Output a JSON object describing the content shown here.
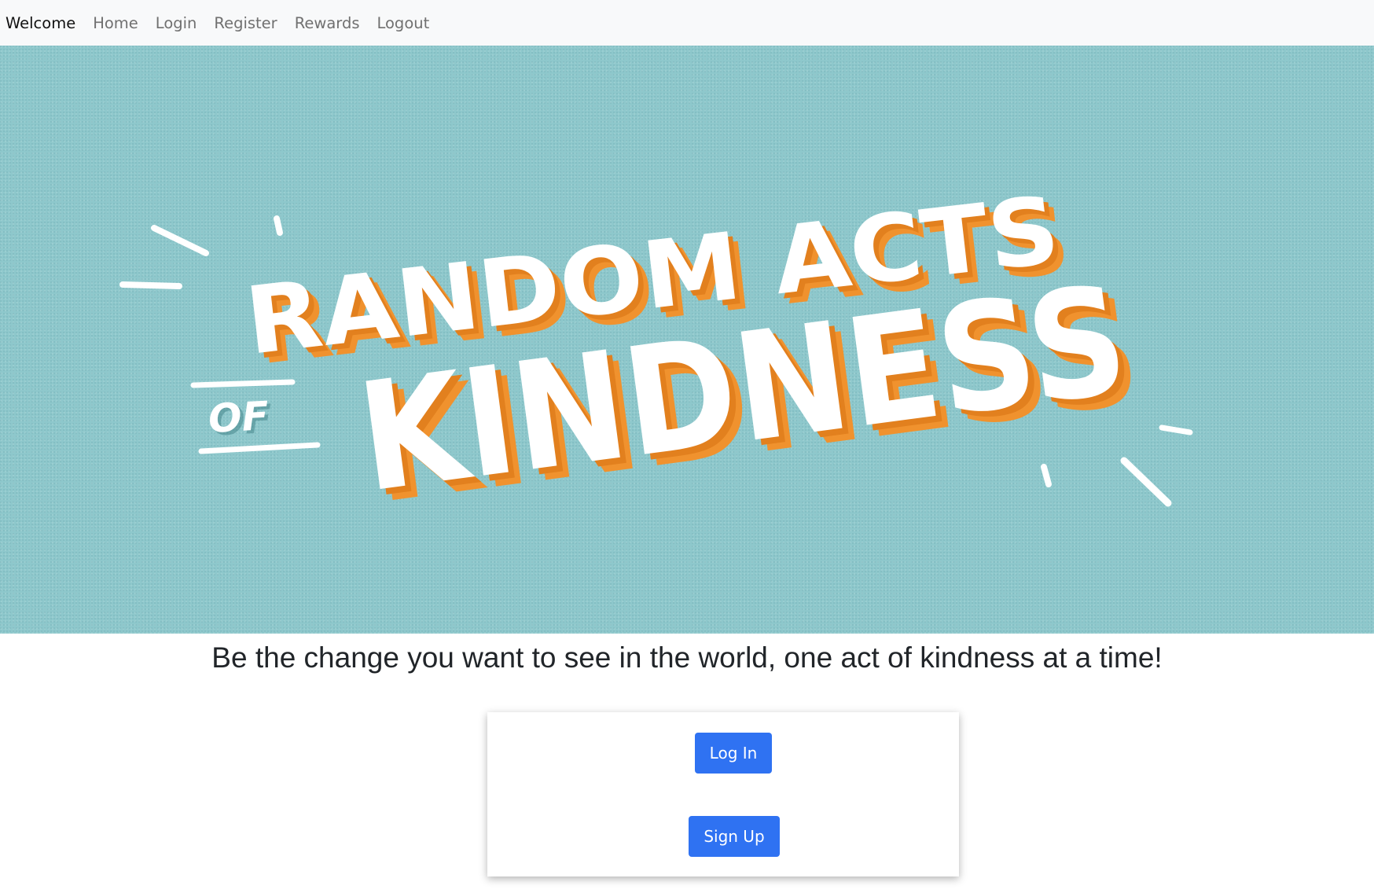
{
  "nav": {
    "brand": "Welcome",
    "links": [
      {
        "label": "Home"
      },
      {
        "label": "Login"
      },
      {
        "label": "Register"
      },
      {
        "label": "Rewards"
      },
      {
        "label": "Logout"
      }
    ]
  },
  "hero": {
    "line1": "RANDOM ACTS",
    "of": "OF",
    "line2": "KINDNESS",
    "background_color": "#8ec8cc",
    "letter_color": "#ffffff",
    "shadow_color": "#f0922e"
  },
  "tagline": "Be the change you want to see in the world, one act of kindness at a time!",
  "auth": {
    "login_label": "Log In",
    "signup_label": "Sign Up",
    "button_color": "#2f72f2"
  }
}
